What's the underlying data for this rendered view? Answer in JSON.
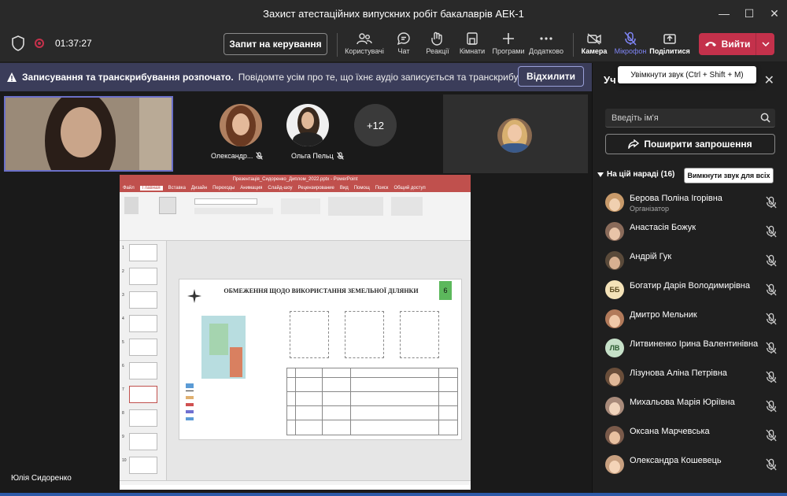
{
  "window": {
    "title": "Захист атестаційних випускних робіт бакалаврів АЕК-1"
  },
  "toolbar": {
    "timer": "01:37:27",
    "request_control": "Запит на керування",
    "items": [
      {
        "label": "Користувачі",
        "icon": "people-icon"
      },
      {
        "label": "Чат",
        "icon": "chat-icon"
      },
      {
        "label": "Реакції",
        "icon": "reactions-icon"
      },
      {
        "label": "Кімнати",
        "icon": "rooms-icon"
      },
      {
        "label": "Програми",
        "icon": "apps-icon"
      },
      {
        "label": "Додатково",
        "icon": "more-icon"
      },
      {
        "label": "Камера",
        "icon": "camera-off-icon"
      },
      {
        "label": "Мікрофон",
        "icon": "mic-off-icon"
      },
      {
        "label": "Поділитися",
        "icon": "share-icon"
      }
    ],
    "leave": "Вийти"
  },
  "banner": {
    "bold": "Записування та транскрибування розпочато.",
    "text": "Повідомте усім про те, що їхнє аудіо записується та транскрибується. П...",
    "dismiss": "Відхилити"
  },
  "stage": {
    "participants": [
      {
        "name": "Олександр..."
      },
      {
        "name": "Ольга Пельц"
      }
    ],
    "more": "+12",
    "presenter": "Юлія Сидоренко"
  },
  "presentation": {
    "window_title": "Презентація_Сидоренко_Диплом_2022.pptx - PowerPoint",
    "tabs": [
      "Файл",
      "Главная",
      "Вставка",
      "Дизайн",
      "Переходы",
      "Анимация",
      "Слайд-шоу",
      "Рецензирование",
      "Вид",
      "Помощ",
      "Поиск",
      "Общий доступ"
    ],
    "slide_title": "ОБМЕЖЕННЯ ЩОДО ВИКОРИСТАННЯ ЗЕМЕЛЬНОЇ ДІЛЯНКИ",
    "slide_number": "6",
    "thumb_numbers": [
      "1",
      "2",
      "3",
      "4",
      "5",
      "6",
      "7",
      "8",
      "9",
      "10"
    ]
  },
  "tooltip": "Увімкнути звук (Ctrl + Shift + M)",
  "panel": {
    "title": "Уч",
    "search_placeholder": "Введіть ім'я",
    "invite": "Поширити запрошення",
    "section": "На цій нараді (16)",
    "mute_all": "Вимкнути звук для всіх",
    "people": [
      {
        "name": "Берова Поліна Ігорівна",
        "role": "Організатор",
        "initials": "",
        "color": "#c89a6a"
      },
      {
        "name": "Анастасія Божук",
        "role": "",
        "initials": "",
        "color": "#8a6b5a"
      },
      {
        "name": "Андрій Гук",
        "role": "",
        "initials": "",
        "color": "#5a4a3a"
      },
      {
        "name": "Богатир Дарія Володимирівна",
        "role": "",
        "initials": "ББ",
        "color": "#f4e2b8"
      },
      {
        "name": "Дмитро Мельник",
        "role": "",
        "initials": "",
        "color": "#b27a5a"
      },
      {
        "name": "Литвиненко Ірина Валентинівна",
        "role": "",
        "initials": "ЛВ",
        "color": "#c6e0c8"
      },
      {
        "name": "Лізунова Аліна Петрівна",
        "role": "",
        "initials": "",
        "color": "#6a4e3a"
      },
      {
        "name": "Михальова Марія Юріївна",
        "role": "",
        "initials": "",
        "color": "#a88a7a"
      },
      {
        "name": "Оксана Марчевська",
        "role": "",
        "initials": "",
        "color": "#7a5a4a"
      },
      {
        "name": "Олександра Кошевець",
        "role": "",
        "initials": "",
        "color": "#c8a080"
      }
    ]
  },
  "colors": {
    "accent": "#7f85f5",
    "leave": "#c4314b",
    "banner": "#3b3d5a",
    "pp_red": "#c0504d"
  }
}
